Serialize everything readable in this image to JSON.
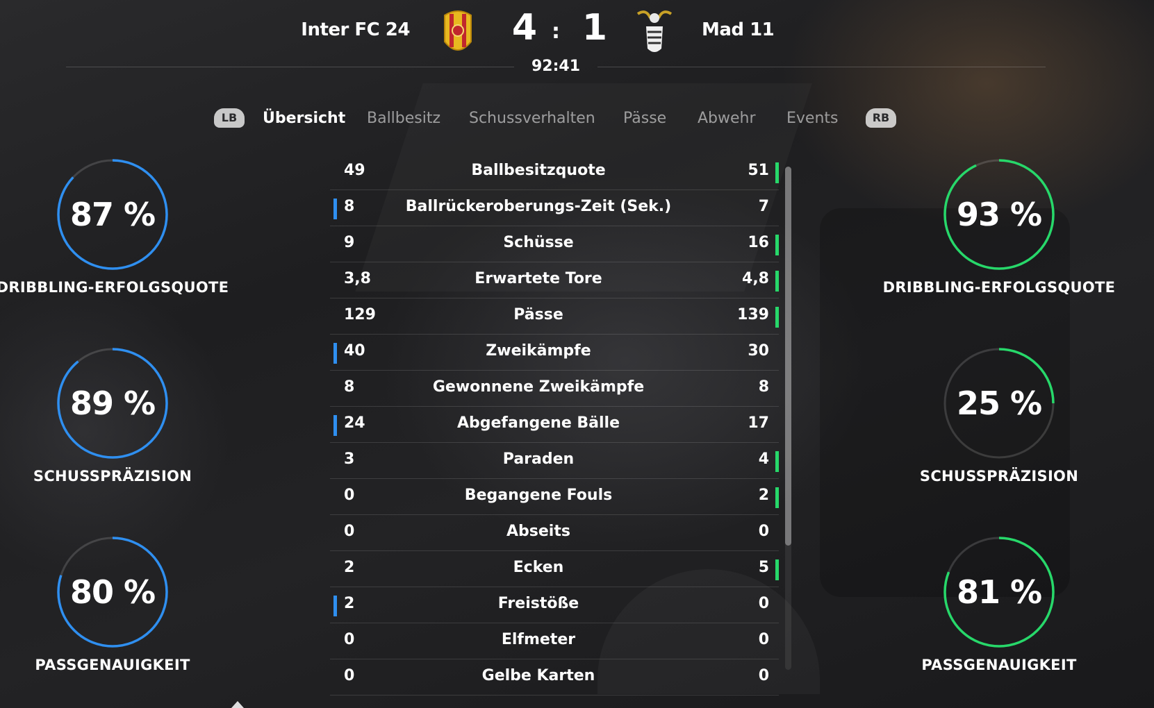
{
  "match": {
    "home_team": "Inter FC 24",
    "away_team": "Mad 11",
    "home_score": "4",
    "separator": ":",
    "away_score": "1",
    "clock": "92:41",
    "home_color": "#2f8ff0",
    "away_color": "#27d86a"
  },
  "tabs": {
    "lb": "LB",
    "rb": "RB",
    "items": [
      "Übersicht",
      "Ballbesitz",
      "Schussverhalten",
      "Pässe",
      "Abwehr",
      "Events"
    ],
    "active": "Übersicht"
  },
  "home_gauges": [
    {
      "value": "87 %",
      "pct": 87,
      "label": "DRIBBLING-ERFOLGSQUOTE"
    },
    {
      "value": "89 %",
      "pct": 89,
      "label": "SCHUSSPRÄZISION"
    },
    {
      "value": "80 %",
      "pct": 80,
      "label": "PASSGENAUIGKEIT"
    }
  ],
  "away_gauges": [
    {
      "value": "93 %",
      "pct": 93,
      "label": "DRIBBLING-ERFOLGSQUOTE"
    },
    {
      "value": "25 %",
      "pct": 25,
      "label": "SCHUSSPRÄZISION"
    },
    {
      "value": "81 %",
      "pct": 81,
      "label": "PASSGENAUIGKEIT"
    }
  ],
  "stats": [
    {
      "home": "49",
      "name": "Ballbesitzquote",
      "away": "51",
      "lead": "away"
    },
    {
      "home": "8",
      "name": "Ballrückeroberungs-Zeit (Sek.)",
      "away": "7",
      "lead": "home"
    },
    {
      "home": "9",
      "name": "Schüsse",
      "away": "16",
      "lead": "away"
    },
    {
      "home": "3,8",
      "name": "Erwartete Tore",
      "away": "4,8",
      "lead": "away"
    },
    {
      "home": "129",
      "name": "Pässe",
      "away": "139",
      "lead": "away"
    },
    {
      "home": "40",
      "name": "Zweikämpfe",
      "away": "30",
      "lead": "home"
    },
    {
      "home": "8",
      "name": "Gewonnene Zweikämpfe",
      "away": "8",
      "lead": "none"
    },
    {
      "home": "24",
      "name": "Abgefangene Bälle",
      "away": "17",
      "lead": "home"
    },
    {
      "home": "3",
      "name": "Paraden",
      "away": "4",
      "lead": "away"
    },
    {
      "home": "0",
      "name": "Begangene Fouls",
      "away": "2",
      "lead": "away"
    },
    {
      "home": "0",
      "name": "Abseits",
      "away": "0",
      "lead": "none"
    },
    {
      "home": "2",
      "name": "Ecken",
      "away": "5",
      "lead": "away"
    },
    {
      "home": "2",
      "name": "Freistöße",
      "away": "0",
      "lead": "home"
    },
    {
      "home": "0",
      "name": "Elfmeter",
      "away": "0",
      "lead": "none"
    },
    {
      "home": "0",
      "name": "Gelbe Karten",
      "away": "0",
      "lead": "none"
    }
  ]
}
